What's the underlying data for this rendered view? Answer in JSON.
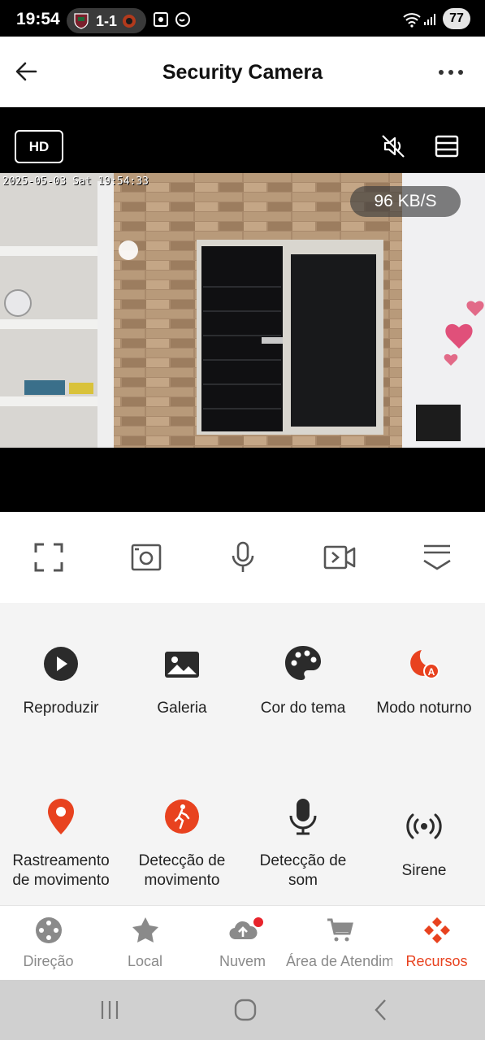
{
  "status_bar": {
    "time": "19:54",
    "score": "1-1",
    "battery": "77"
  },
  "header": {
    "title": "Security Camera"
  },
  "video": {
    "quality_badge": "HD",
    "timestamp_overlay": "2025-05-03 Sat 19:54:33",
    "speed": "96 KB/S"
  },
  "features": [
    {
      "label": "Reproduzir",
      "icon": "play-circle-icon"
    },
    {
      "label": "Galeria",
      "icon": "image-icon"
    },
    {
      "label": "Cor do tema",
      "icon": "palette-icon"
    },
    {
      "label": "Modo noturno",
      "icon": "night-mode-icon"
    },
    {
      "label": "Rastreamento de movimento",
      "line1": "Rastreamento",
      "line2": "de movimento",
      "icon": "location-pin-icon"
    },
    {
      "label": "Detecção de movimento",
      "line1": "Detecção de",
      "line2": "movimento",
      "icon": "walking-person-icon"
    },
    {
      "label": "Detecção de som",
      "line1": "Detecção de",
      "line2": "som",
      "icon": "microphone-icon"
    },
    {
      "label": "Sirene",
      "icon": "siren-icon"
    }
  ],
  "bottom_nav": [
    {
      "label": "Direção",
      "icon": "joystick-icon"
    },
    {
      "label": "Local",
      "icon": "star-icon"
    },
    {
      "label": "Nuvem",
      "icon": "cloud-upload-icon"
    },
    {
      "label": "Área de Atendim...",
      "icon": "cart-icon"
    },
    {
      "label": "Recursos",
      "icon": "apps-icon",
      "active": true
    }
  ],
  "colors": {
    "accent": "#e8421f",
    "header_bg": "#ffffff",
    "video_bg": "#000000"
  }
}
